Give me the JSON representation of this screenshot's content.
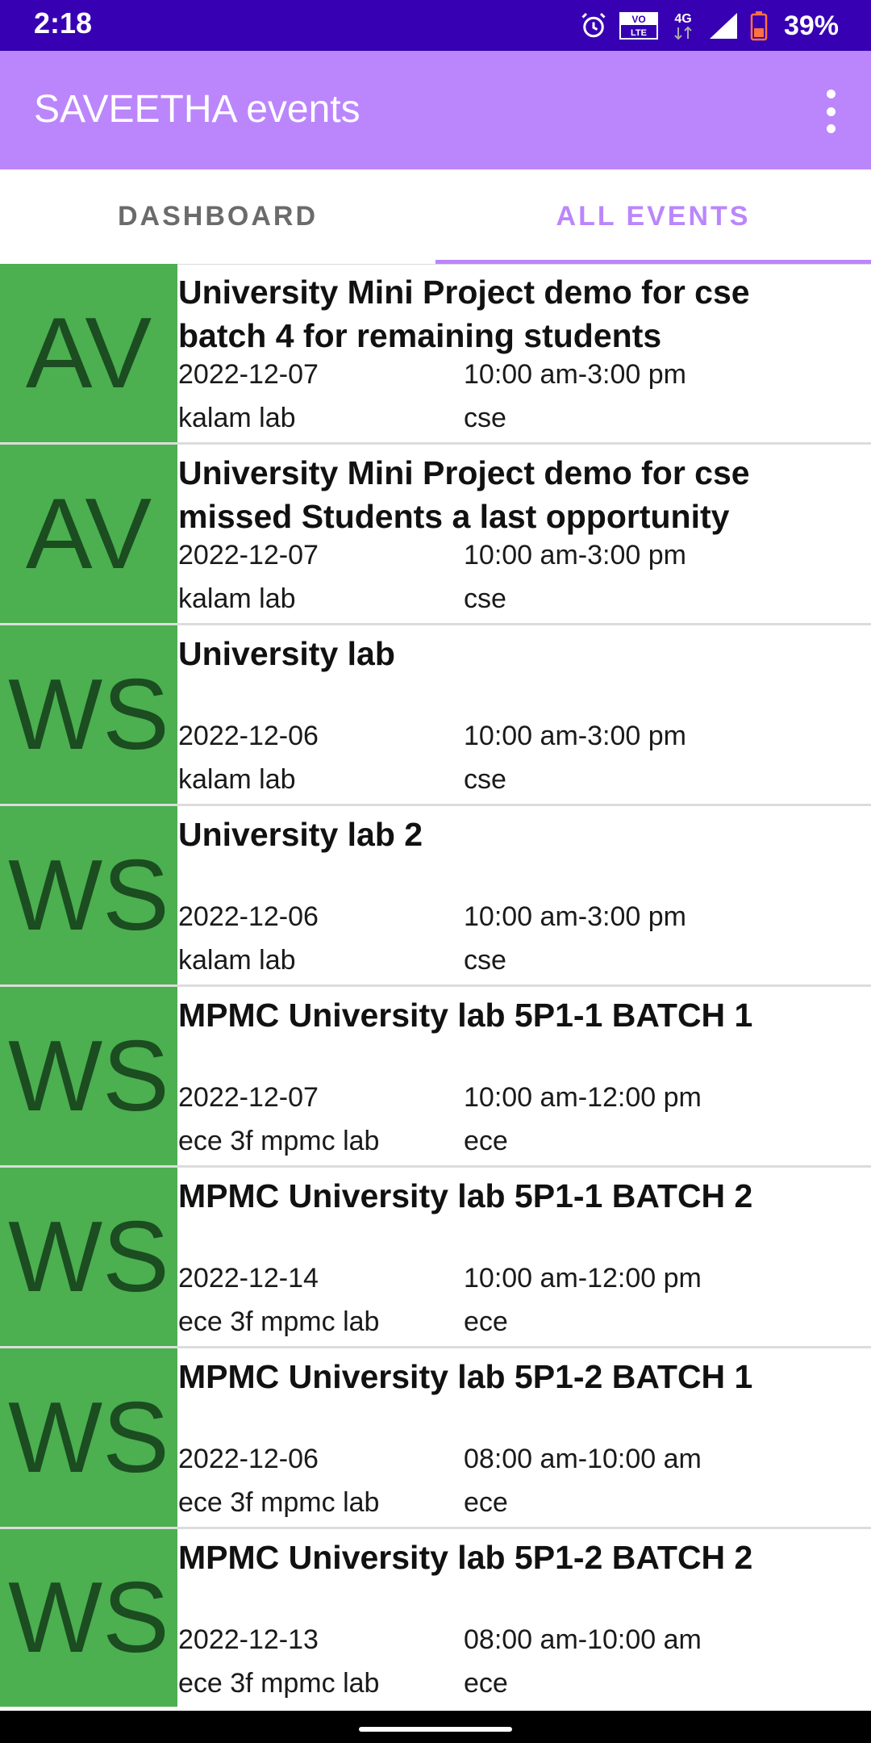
{
  "status": {
    "time": "2:18",
    "battery_percent": "39%",
    "network": "4G",
    "volte": "VoLTE",
    "icons": [
      "alarm-icon",
      "volte-icon",
      "network-4g-icon",
      "signal-icon",
      "battery-icon"
    ]
  },
  "appbar": {
    "title": "SAVEETHA events",
    "color": "#bb86fc"
  },
  "tabs": [
    {
      "label": "DASHBOARD",
      "active": false
    },
    {
      "label": "ALL EVENTS",
      "active": true
    }
  ],
  "events": [
    {
      "badge": "AV",
      "title": "University Mini Project demo for cse batch 4 for remaining students",
      "date": "2022-12-07",
      "time": "10:00 am-3:00 pm",
      "venue": "kalam lab",
      "dept": "cse"
    },
    {
      "badge": "AV",
      "title": "University Mini Project demo for cse missed Students a last opportunity",
      "date": "2022-12-07",
      "time": "10:00 am-3:00 pm",
      "venue": "kalam lab",
      "dept": "cse"
    },
    {
      "badge": "WS",
      "title": "University lab",
      "date": "2022-12-06",
      "time": "10:00 am-3:00 pm",
      "venue": "kalam lab",
      "dept": "cse"
    },
    {
      "badge": "WS",
      "title": "University lab 2",
      "date": "2022-12-06",
      "time": "10:00 am-3:00 pm",
      "venue": "kalam lab",
      "dept": "cse"
    },
    {
      "badge": "WS",
      "title": "MPMC University lab 5P1-1 BATCH 1",
      "date": "2022-12-07",
      "time": "10:00 am-12:00 pm",
      "venue": "ece 3f mpmc lab",
      "dept": "ece"
    },
    {
      "badge": "WS",
      "title": "MPMC University lab 5P1-1 BATCH 2",
      "date": "2022-12-14",
      "time": "10:00 am-12:00 pm",
      "venue": "ece 3f mpmc lab",
      "dept": "ece"
    },
    {
      "badge": "WS",
      "title": "MPMC University lab 5P1-2 BATCH 1",
      "date": "2022-12-06",
      "time": "08:00 am-10:00 am",
      "venue": "ece 3f mpmc lab",
      "dept": "ece"
    },
    {
      "badge": "WS",
      "title": "MPMC University lab 5P1-2 BATCH 2",
      "date": "2022-12-13",
      "time": "08:00 am-10:00 am",
      "venue": "ece 3f mpmc lab",
      "dept": "ece"
    }
  ],
  "colors": {
    "status_bar": "#3700b3",
    "badge_bg": "#4caf50",
    "badge_text": "#1b4d21",
    "tab_active": "#bb86fc"
  }
}
